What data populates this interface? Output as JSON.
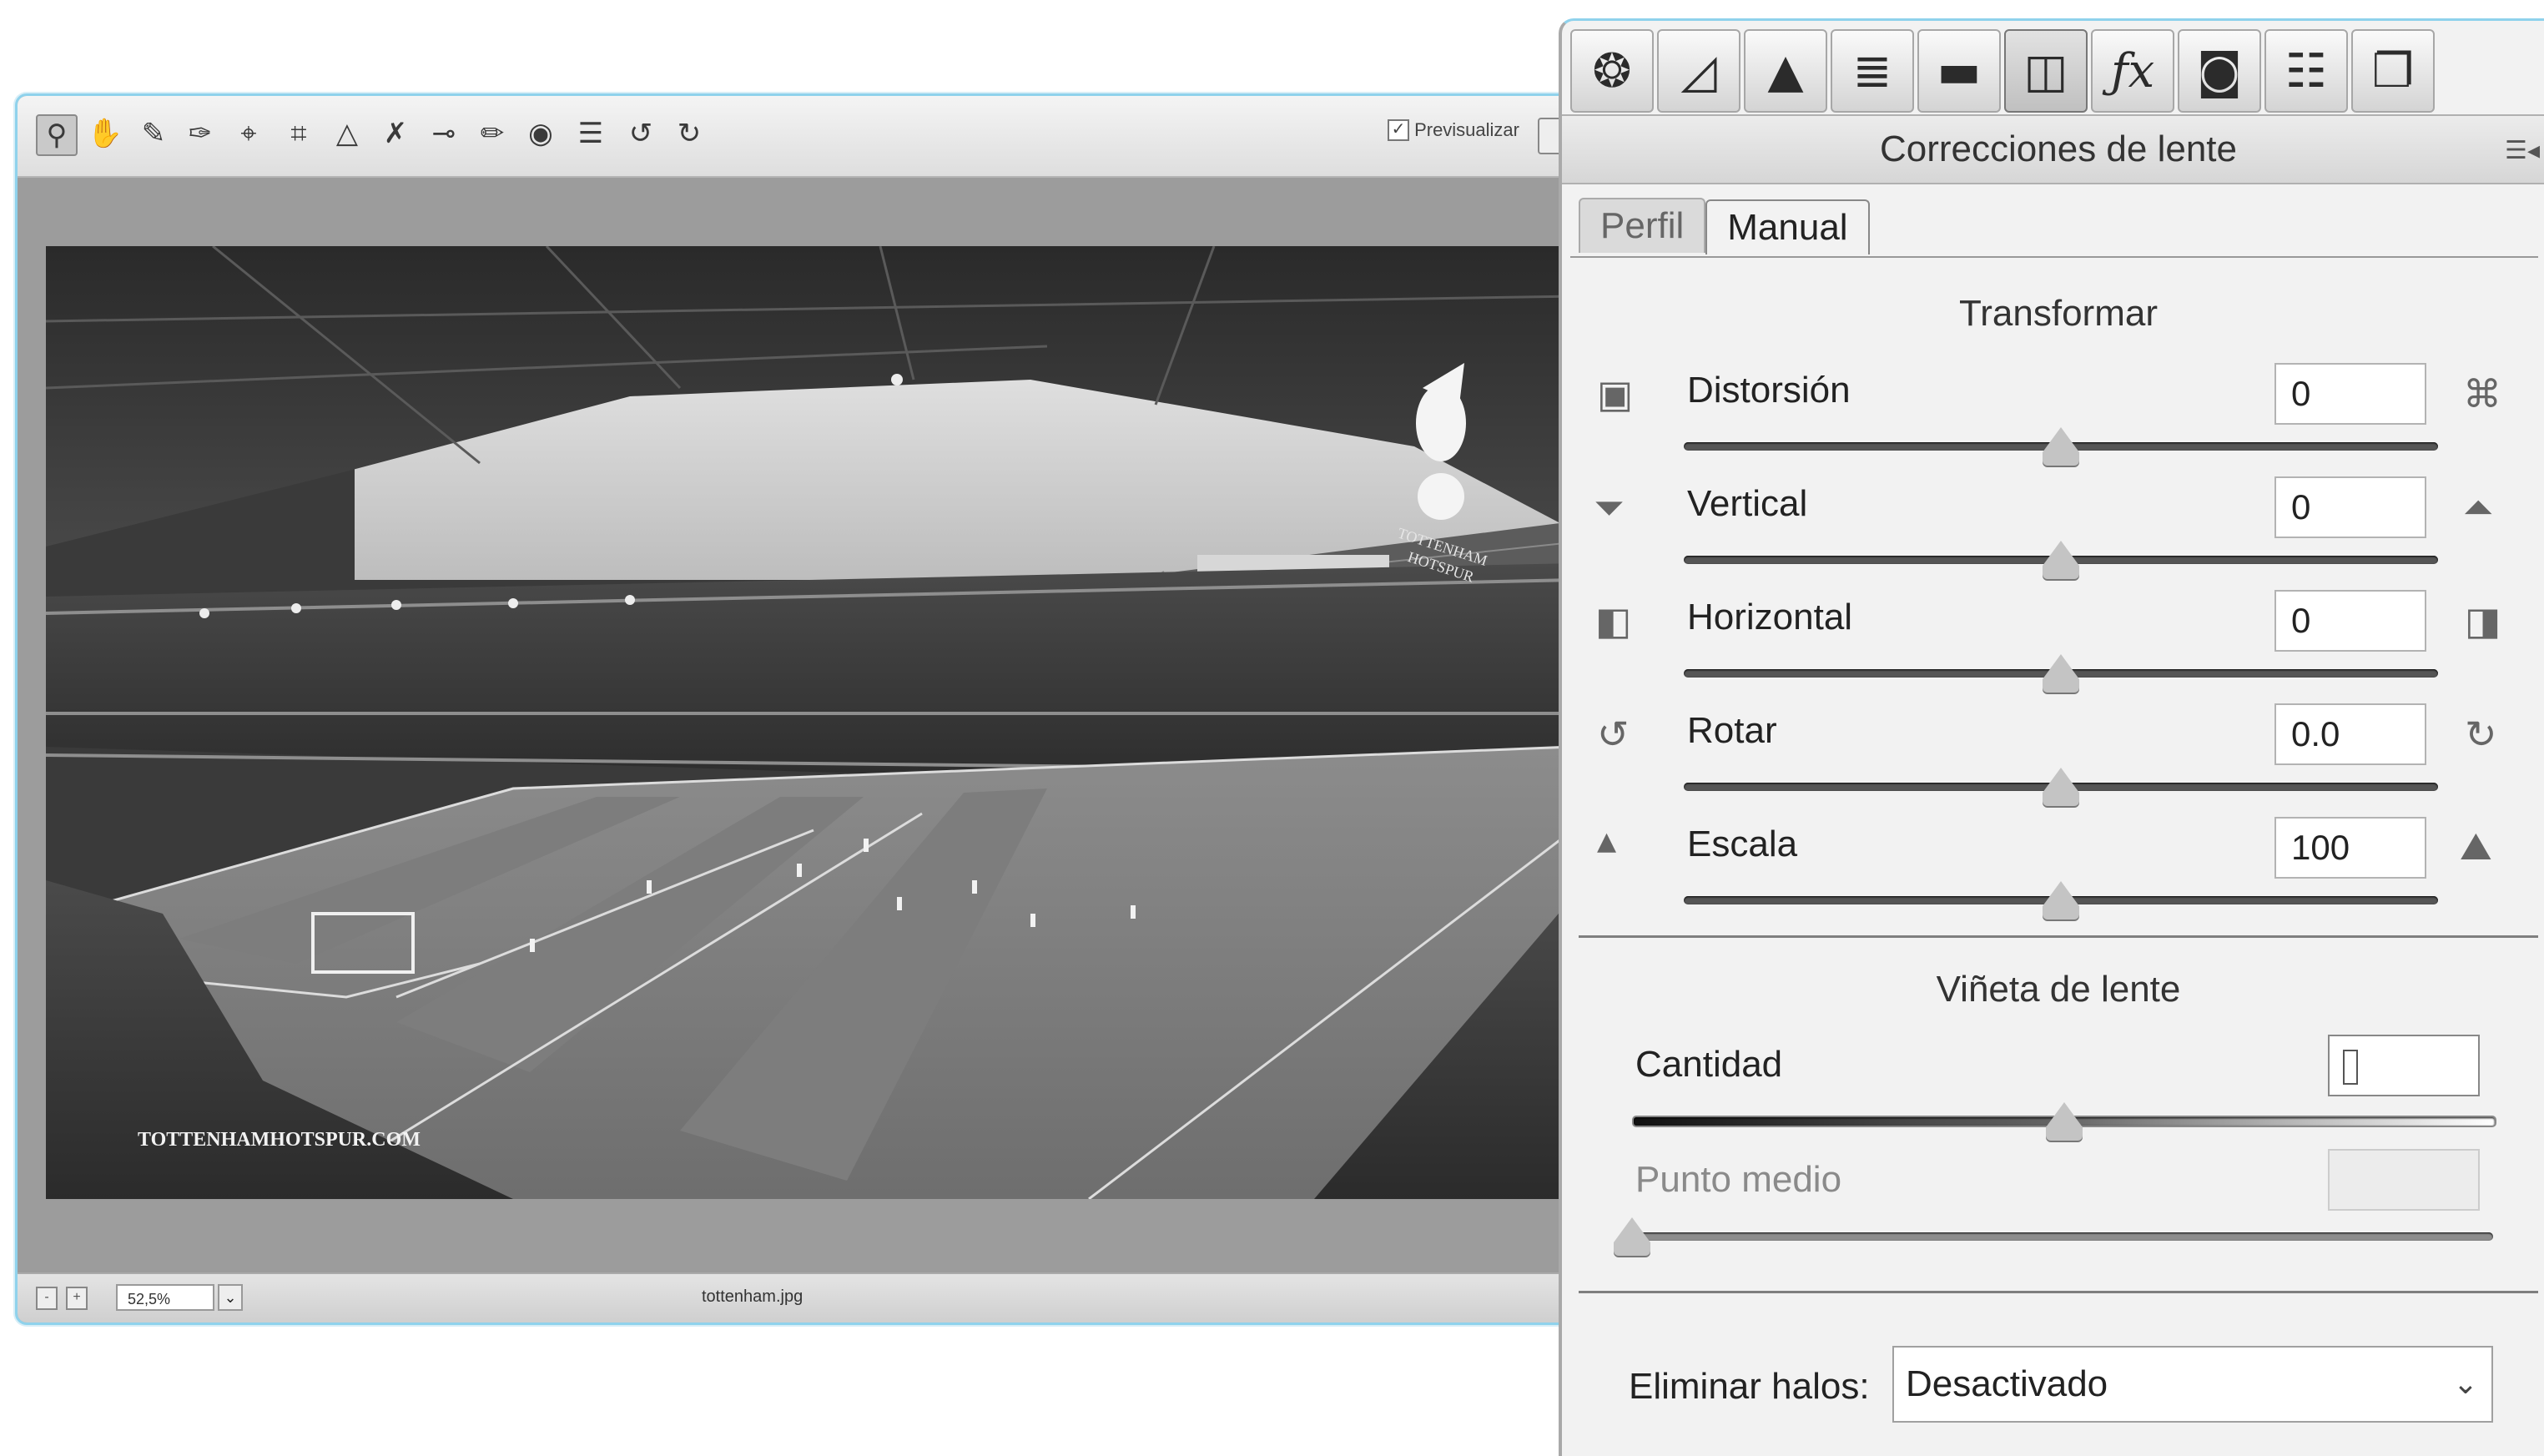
{
  "editor": {
    "preview_label": "Previsualizar",
    "preview_checked": true,
    "zoom": "52,5%",
    "filename": "tottenham.jpg",
    "tools": [
      "zoom-icon",
      "hand-icon",
      "eyedropper-icon",
      "color-sampler-icon",
      "target-adjust-icon",
      "crop-icon",
      "straighten-icon",
      "spot-removal-icon",
      "red-eye-icon",
      "adjustment-brush-icon",
      "graduated-filter-icon",
      "list-icon",
      "rotate-left-icon",
      "rotate-right-icon"
    ],
    "photo": {
      "watermark": "TOTTENHAMHOTSPUR.COM",
      "crest_text_1": "TOTTENHAM",
      "crest_text_2": "HOTSPUR"
    }
  },
  "panel": {
    "icon_tabs": [
      "basic-icon",
      "tone-curve-icon",
      "detail-icon",
      "hsl-icon",
      "split-toning-icon",
      "lens-corrections-icon",
      "effects-icon",
      "camera-calibration-icon",
      "presets-icon",
      "snapshots-icon"
    ],
    "title": "Correcciones de lente",
    "subtabs": {
      "profile": "Perfil",
      "manual": "Manual"
    },
    "transform": {
      "title": "Transformar",
      "rows": [
        {
          "label": "Distorsión",
          "value": "0",
          "position": 0.5
        },
        {
          "label": "Vertical",
          "value": "0",
          "position": 0.5
        },
        {
          "label": "Horizontal",
          "value": "0",
          "position": 0.5
        },
        {
          "label": "Rotar",
          "value": "0.0",
          "position": 0.5
        },
        {
          "label": "Escala",
          "value": "100",
          "position": 0.5
        }
      ]
    },
    "vignette": {
      "title": "Viñeta de lente",
      "amount_label": "Cantidad",
      "amount_position": 0.5,
      "midpoint_label": "Punto medio",
      "midpoint_position": 0.0
    },
    "defringe": {
      "label": "Eliminar halos:",
      "value": "Desactivado"
    }
  }
}
